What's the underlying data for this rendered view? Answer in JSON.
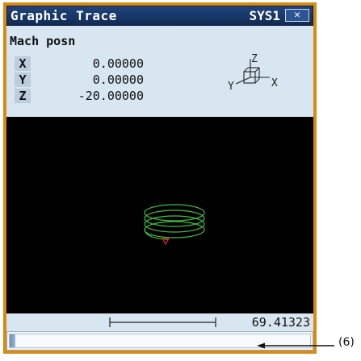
{
  "window": {
    "title": "Graphic Trace",
    "system": "SYS1",
    "close_glyph": "✕"
  },
  "machine_position": {
    "heading": "Mach posn",
    "axes": [
      {
        "label": "X",
        "value": "0.00000"
      },
      {
        "label": "Y",
        "value": "0.00000"
      },
      {
        "label": "Z",
        "value": "-20.00000"
      }
    ],
    "orientation_glyph": {
      "x": "X",
      "y": "Y",
      "z": "Z",
      "icon": "axis-cube-icon"
    }
  },
  "viewport": {
    "background": "#000000",
    "trace_color": "#3fc03f",
    "tool_color": "#d02030"
  },
  "scale": {
    "value": "69.41323"
  },
  "progress": {
    "fraction": 0.02
  },
  "callout": {
    "label": "(6)"
  },
  "colors": {
    "frame": "#d98a12",
    "titlebar": "#173565",
    "panel": "#d7e6f0"
  }
}
